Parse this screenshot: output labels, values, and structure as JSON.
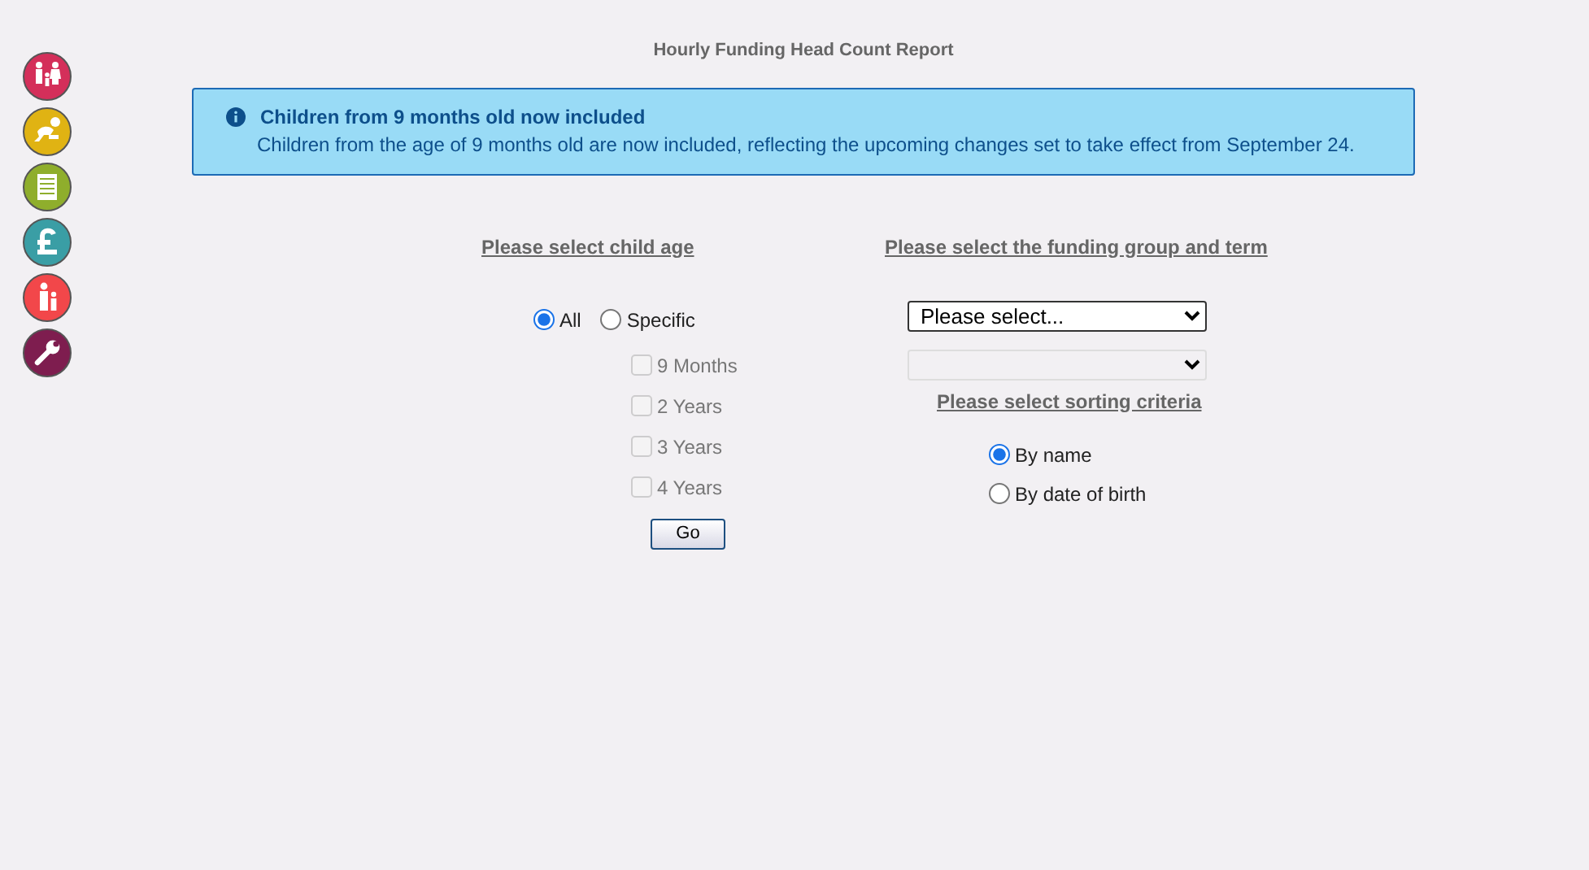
{
  "sidebar": {
    "items": [
      {
        "kind": "family",
        "color": "#d42f5a"
      },
      {
        "kind": "baby",
        "color": "#e0b313"
      },
      {
        "kind": "document",
        "color": "#8fae2c"
      },
      {
        "kind": "pound",
        "color": "#3a9ea5"
      },
      {
        "kind": "parent",
        "color": "#f2474a"
      },
      {
        "kind": "wrench",
        "color": "#7e1d4f"
      }
    ]
  },
  "title": "Hourly Funding Head Count Report",
  "notice": {
    "title": "Children from 9 months old now included",
    "text": "Children from the age of 9 months old are now included, reflecting the upcoming changes set to take effect from September 24."
  },
  "child_age": {
    "heading": "Please select child age",
    "options": [
      {
        "label": "All",
        "selected": true
      },
      {
        "label": "Specific",
        "selected": false
      }
    ],
    "ages": [
      {
        "label": "9 Months",
        "checked": false,
        "disabled": true
      },
      {
        "label": "2 Years",
        "checked": false,
        "disabled": true
      },
      {
        "label": "3 Years",
        "checked": false,
        "disabled": true
      },
      {
        "label": "4 Years",
        "checked": false,
        "disabled": true
      }
    ],
    "button": "Go"
  },
  "funding": {
    "heading": "Please select the funding group and term",
    "selects": [
      {
        "value": "Please select...",
        "disabled": false
      },
      {
        "disabled": true
      }
    ],
    "sort_heading": "Please select sorting criteria",
    "sort_options": [
      {
        "label": "By name",
        "selected": true
      },
      {
        "label": "By date of birth",
        "selected": false
      }
    ]
  }
}
